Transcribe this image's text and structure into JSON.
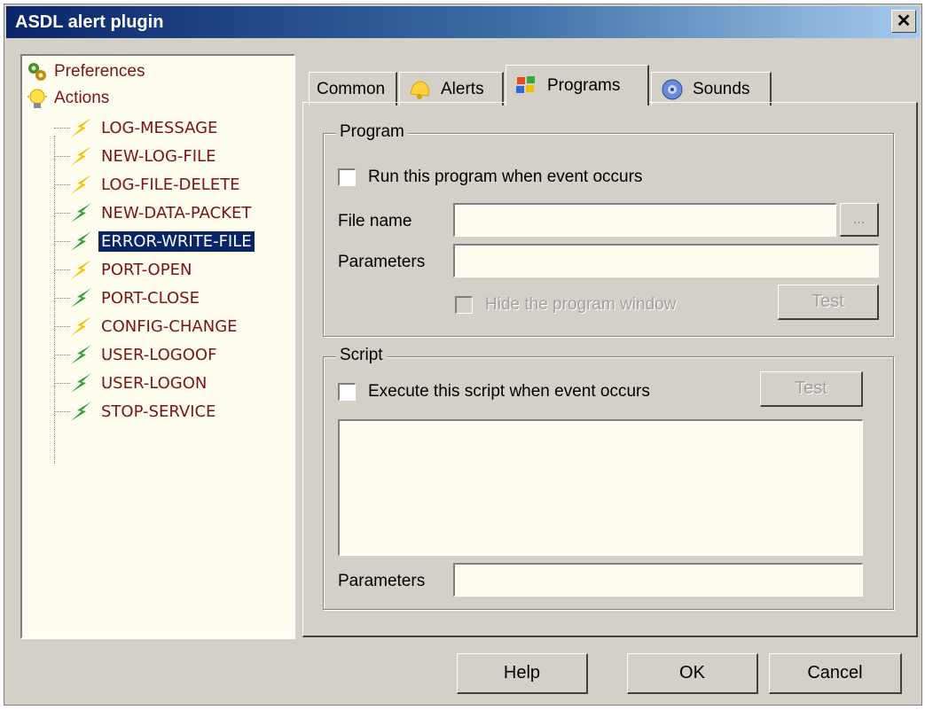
{
  "window": {
    "title": "ASDL alert plugin",
    "close_label": "✕"
  },
  "tree": {
    "roots": [
      {
        "label": "Preferences",
        "icon": "preferences-icon"
      },
      {
        "label": "Actions",
        "icon": "lightbulb-icon"
      }
    ],
    "items": [
      {
        "label": "LOG-MESSAGE",
        "icon_color": "#f0c000"
      },
      {
        "label": "NEW-LOG-FILE",
        "icon_color": "#f0c000"
      },
      {
        "label": "LOG-FILE-DELETE",
        "icon_color": "#f0c000"
      },
      {
        "label": "NEW-DATA-PACKET",
        "icon_color": "#2aa02a"
      },
      {
        "label": "ERROR-WRITE-FILE",
        "icon_color": "#2aa02a",
        "selected": true
      },
      {
        "label": "PORT-OPEN",
        "icon_color": "#f0c000"
      },
      {
        "label": "PORT-CLOSE",
        "icon_color": "#2aa02a"
      },
      {
        "label": "CONFIG-CHANGE",
        "icon_color": "#f0c000"
      },
      {
        "label": "USER-LOGOOF",
        "icon_color": "#2aa02a"
      },
      {
        "label": "USER-LOGON",
        "icon_color": "#2aa02a"
      },
      {
        "label": "STOP-SERVICE",
        "icon_color": "#2aa02a"
      }
    ]
  },
  "tabs": [
    {
      "label": "Common"
    },
    {
      "label": "Alerts"
    },
    {
      "label": "Programs",
      "active": true
    },
    {
      "label": "Sounds"
    }
  ],
  "program": {
    "legend": "Program",
    "run_label": "Run this program when event occurs",
    "file_name_label": "File name",
    "file_name_value": "",
    "browse_label": "...",
    "parameters_label": "Parameters",
    "parameters_value": "",
    "hide_label": "Hide the program window",
    "test_label": "Test"
  },
  "script": {
    "legend": "Script",
    "execute_label": "Execute this script when event occurs",
    "test_label": "Test",
    "script_value": "",
    "parameters_label": "Parameters",
    "parameters_value": ""
  },
  "buttons": {
    "help": "Help",
    "ok": "OK",
    "cancel": "Cancel"
  }
}
